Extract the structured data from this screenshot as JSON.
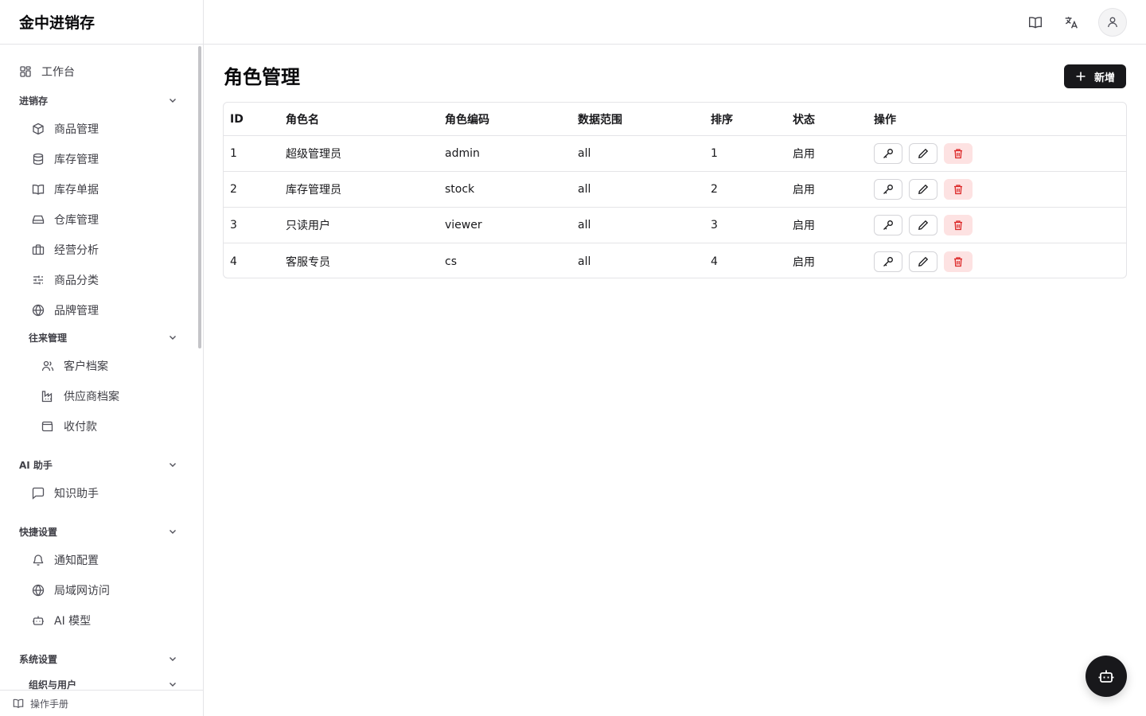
{
  "app": {
    "brand": "金中进销存"
  },
  "sidebar": {
    "workbench": "工作台",
    "groups": {
      "inventory": "进销存",
      "contacts": "往来管理",
      "ai": "AI 助手",
      "shortcuts": "快捷设置",
      "system": "系统设置",
      "org": "组织与用户"
    },
    "items": {
      "products": "商品管理",
      "stock": "库存管理",
      "documents": "库存单据",
      "warehouse": "仓库管理",
      "analysis": "经营分析",
      "category": "商品分类",
      "brand": "品牌管理",
      "customers": "客户档案",
      "suppliers": "供应商档案",
      "payments": "收付款",
      "knowledge": "知识助手",
      "notify": "通知配置",
      "lan": "局域网访问",
      "ai_model": "AI 模型"
    },
    "manual": "操作手册"
  },
  "page": {
    "title": "角色管理",
    "add_label": "新增"
  },
  "table": {
    "headers": [
      "ID",
      "角色名",
      "角色编码",
      "数据范围",
      "排序",
      "状态",
      "操作"
    ],
    "rows": [
      [
        "1",
        "超级管理员",
        "admin",
        "all",
        "1",
        "启用"
      ],
      [
        "2",
        "库存管理员",
        "stock",
        "all",
        "2",
        "启用"
      ],
      [
        "3",
        "只读用户",
        "viewer",
        "all",
        "3",
        "启用"
      ],
      [
        "4",
        "客服专员",
        "cs",
        "all",
        "4",
        "启用"
      ]
    ]
  }
}
